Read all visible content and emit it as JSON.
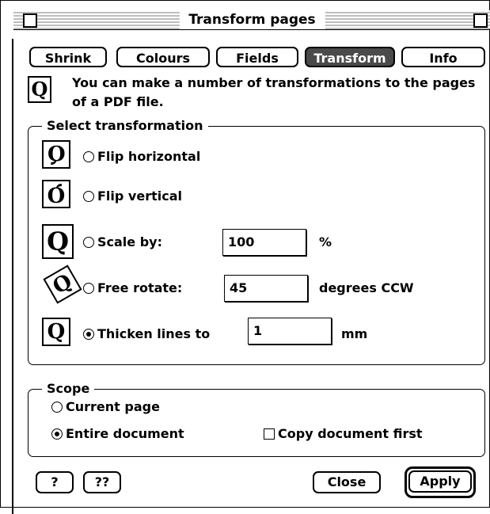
{
  "window": {
    "title": "Transform pages"
  },
  "tabs": [
    {
      "label": "Shrink",
      "active": false
    },
    {
      "label": "Colours",
      "active": false
    },
    {
      "label": "Fields",
      "active": false
    },
    {
      "label": "Transform",
      "active": true
    },
    {
      "label": "Info",
      "active": false
    }
  ],
  "intro": {
    "text": "You can make a number of transformations to the pages of a PDF file."
  },
  "select_group": {
    "legend": "Select transformation",
    "options": [
      {
        "label": "Flip horizontal",
        "selected": false
      },
      {
        "label": "Flip vertical",
        "selected": false
      },
      {
        "label": "Scale by:",
        "value": "100",
        "unit": "%",
        "selected": false
      },
      {
        "label": "Free rotate:",
        "value": "45",
        "unit": "degrees CCW",
        "selected": false
      },
      {
        "label": "Thicken lines to",
        "value": "1",
        "unit": "mm",
        "selected": true
      }
    ]
  },
  "scope_group": {
    "legend": "Scope",
    "options": [
      {
        "label": "Current page",
        "selected": false
      },
      {
        "label": "Entire document",
        "selected": true
      }
    ],
    "copy_first": {
      "label": "Copy document first",
      "checked": false
    }
  },
  "buttons": {
    "help": "?",
    "more_help": "??",
    "close": "Close",
    "apply": "Apply"
  },
  "icons": {
    "glyph": "Q"
  }
}
